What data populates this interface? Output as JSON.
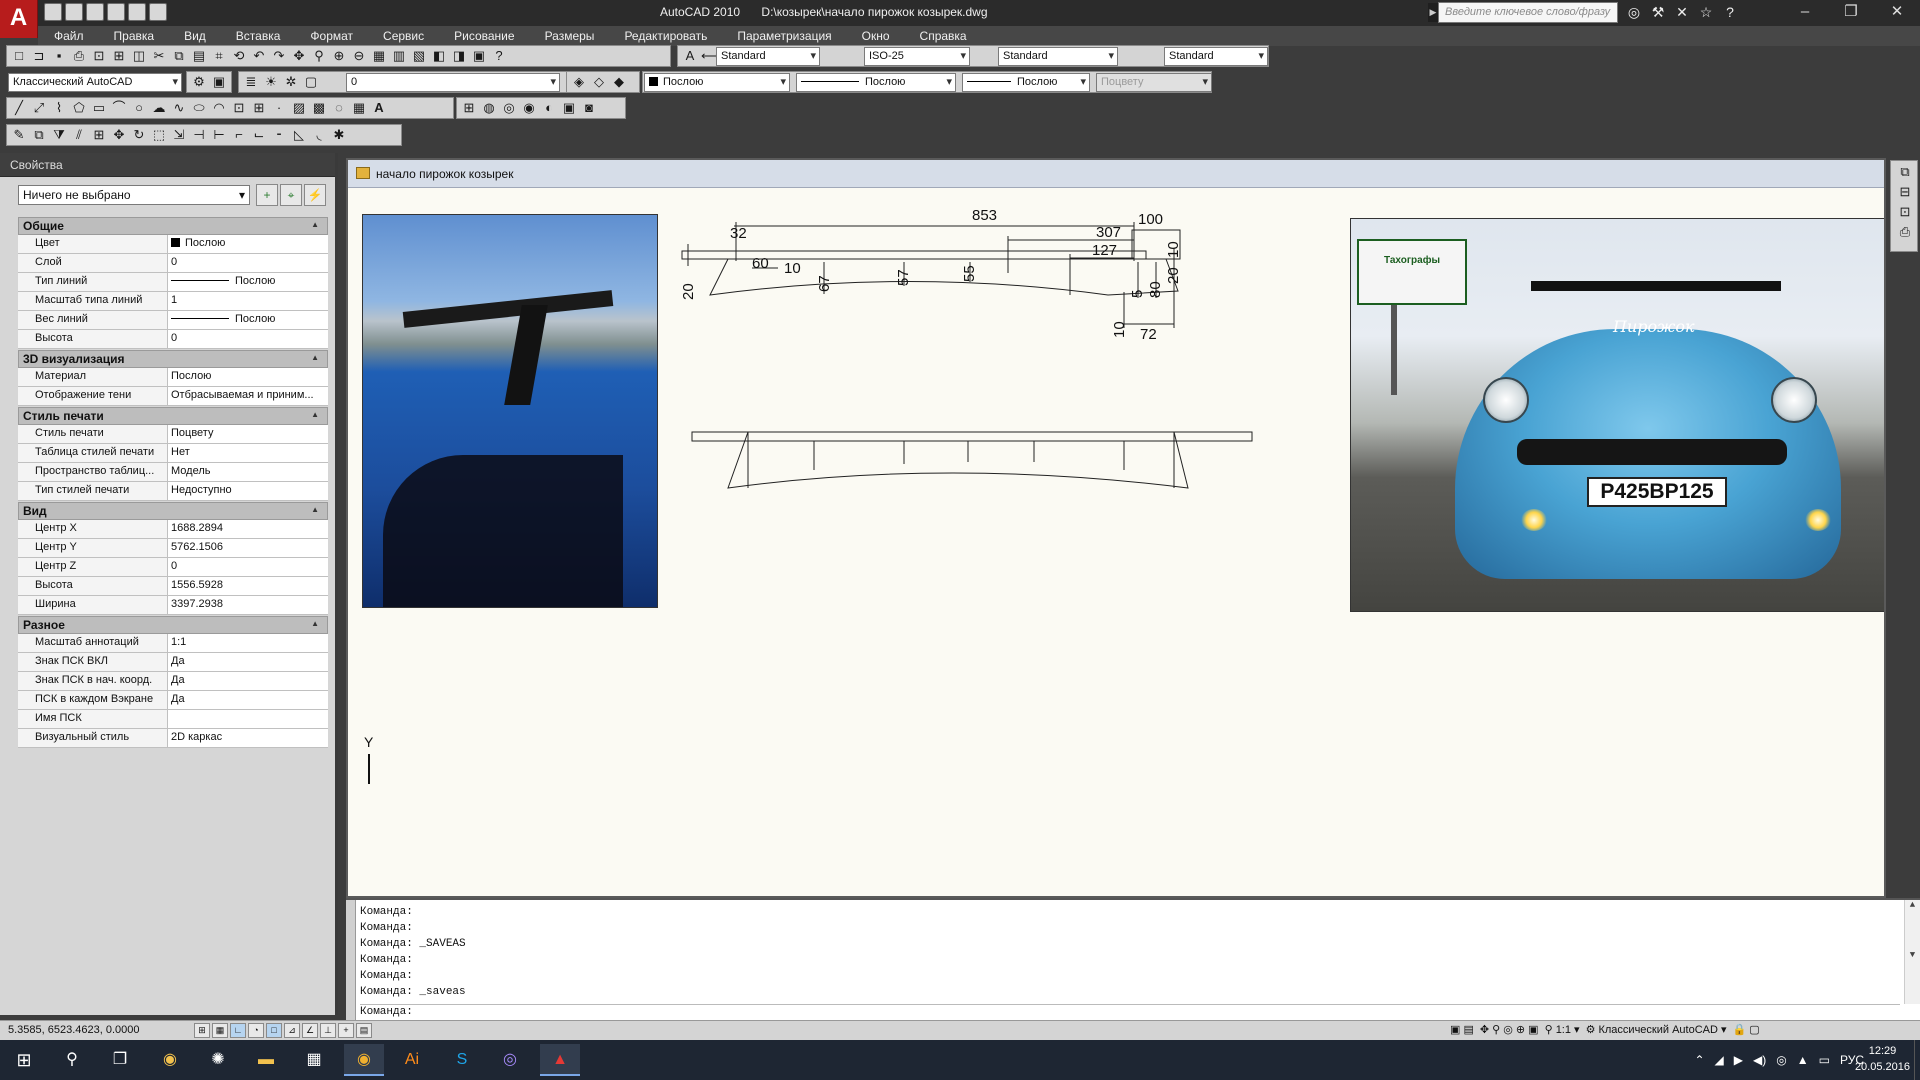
{
  "title_bar": {
    "app_name": "AutoCAD 2010",
    "file_path": "D:\\козырек\\начало пирожок козырек.dwg",
    "search_placeholder": "Введите ключевое слово/фразу"
  },
  "menu": [
    "Файл",
    "Правка",
    "Вид",
    "Вставка",
    "Формат",
    "Сервис",
    "Рисование",
    "Размеры",
    "Редактировать",
    "Параметризация",
    "Окно",
    "Справка"
  ],
  "toolbar_styles": {
    "text_style": "Standard",
    "dim_style": "ISO-25",
    "table_style": "Standard",
    "mleader_style": "Standard"
  },
  "toolbar_layers": {
    "workspace": "Классический AutoCAD",
    "layer": "0",
    "color": "Послою",
    "linetype": "Послою",
    "lineweight": "Послою",
    "plotstyle": "Поцвету"
  },
  "properties": {
    "palette_title": "Свойства",
    "selection": "Ничего не выбрано",
    "categories": [
      {
        "name": "Общие",
        "rows": [
          {
            "name": "Цвет",
            "value": "Послою",
            "kind": "color"
          },
          {
            "name": "Слой",
            "value": "0"
          },
          {
            "name": "Тип линий",
            "value": "Послою",
            "kind": "line"
          },
          {
            "name": "Масштаб типа линий",
            "value": "1"
          },
          {
            "name": "Вес линий",
            "value": "Послою",
            "kind": "line"
          },
          {
            "name": "Высота",
            "value": "0"
          }
        ]
      },
      {
        "name": "3D визуализация",
        "rows": [
          {
            "name": "Материал",
            "value": "Послою"
          },
          {
            "name": "Отображение тени",
            "value": "Отбрасываемая и приним..."
          }
        ]
      },
      {
        "name": "Стиль печати",
        "rows": [
          {
            "name": "Стиль печати",
            "value": "Поцвету"
          },
          {
            "name": "Таблица стилей печати",
            "value": "Нет"
          },
          {
            "name": "Пространство таблиц...",
            "value": "Модель"
          },
          {
            "name": "Тип стилей печати",
            "value": "Недоступно"
          }
        ]
      },
      {
        "name": "Вид",
        "rows": [
          {
            "name": "Центр X",
            "value": "1688.2894"
          },
          {
            "name": "Центр Y",
            "value": "5762.1506"
          },
          {
            "name": "Центр Z",
            "value": "0"
          },
          {
            "name": "Высота",
            "value": "1556.5928"
          },
          {
            "name": "Ширина",
            "value": "3397.2938"
          }
        ]
      },
      {
        "name": "Разное",
        "rows": [
          {
            "name": "Масштаб аннотаций",
            "value": "1:1"
          },
          {
            "name": "Знак ПСК ВКЛ",
            "value": "Да"
          },
          {
            "name": "Знак ПСК в нач. коорд.",
            "value": "Да"
          },
          {
            "name": "ПСК в каждом Вэкране",
            "value": "Да"
          },
          {
            "name": "Имя ПСК",
            "value": ""
          },
          {
            "name": "Визуальный стиль",
            "value": "2D каркас"
          }
        ]
      }
    ]
  },
  "drawing": {
    "tab_title": "начало пирожок козырек",
    "ucs_label": "Y",
    "dimensions": [
      "853",
      "307",
      "100",
      "127",
      "32",
      "60",
      "10",
      "20",
      "67",
      "57",
      "55",
      "5",
      "80",
      "20",
      "10",
      "10",
      "72"
    ],
    "photo_right": {
      "plate_text": "Р425ВР125",
      "billboard_text": "Тахографы",
      "script_text": "Пирожок"
    }
  },
  "command_line": {
    "history": [
      "Команда:",
      "Команда:",
      "Команда:  _SAVEAS",
      "Команда:",
      "Команда:",
      "Команда:  _saveas"
    ],
    "prompt": "Команда:"
  },
  "status_bar": {
    "coords": "5.3585,  6523.4623, 0.0000",
    "annotation_scale": "1:1",
    "workspace": "Классический AutoCAD"
  },
  "taskbar": {
    "language": "РУС",
    "time": "12:29",
    "date": "20.05.2016"
  }
}
